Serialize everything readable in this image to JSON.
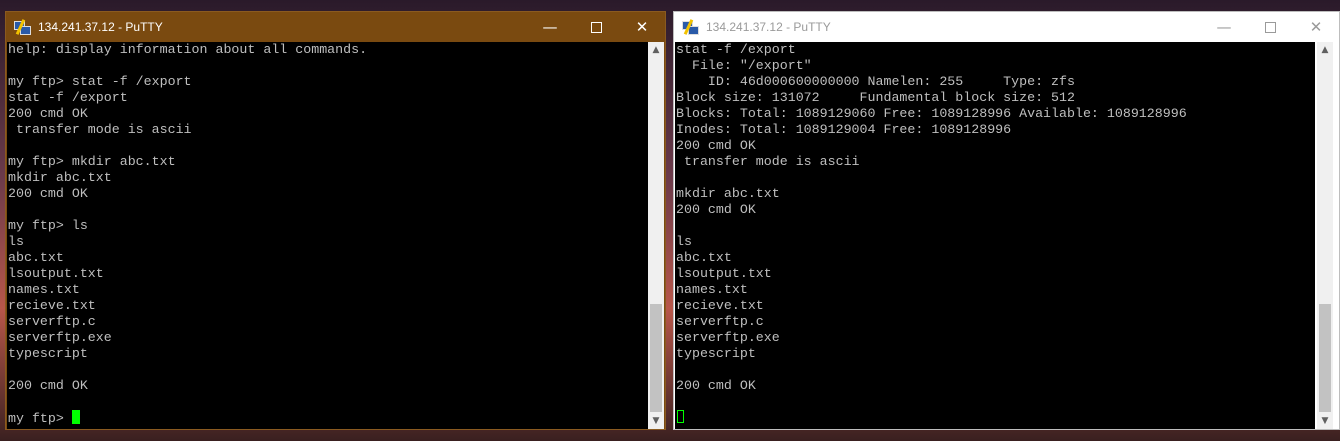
{
  "left_window": {
    "title": "134.241.37.12 - PuTTY",
    "controls": {
      "minimize": "—",
      "close": "✕"
    },
    "lines": [
      "help: display information about all commands.",
      "",
      "my ftp> stat -f /export",
      "stat -f /export",
      "200 cmd OK",
      " transfer mode is ascii",
      "",
      "my ftp> mkdir abc.txt",
      "mkdir abc.txt",
      "200 cmd OK",
      "",
      "my ftp> ls",
      "ls",
      "abc.txt",
      "lsoutput.txt",
      "names.txt",
      "recieve.txt",
      "serverftp.c",
      "serverftp.exe",
      "typescript",
      "",
      "200 cmd OK",
      ""
    ],
    "prompt": "my ftp> ",
    "scroll": {
      "up": "▲",
      "down": "▼"
    }
  },
  "right_window": {
    "title": "134.241.37.12 - PuTTY",
    "controls": {
      "minimize": "—",
      "close": "✕"
    },
    "lines": [
      "stat -f /export",
      "  File: \"/export\"",
      "    ID: 46d000600000000 Namelen: 255     Type: zfs",
      "Block size: 131072     Fundamental block size: 512",
      "Blocks: Total: 1089129060 Free: 1089128996 Available: 1089128996",
      "Inodes: Total: 1089129004 Free: 1089128996",
      "200 cmd OK",
      " transfer mode is ascii",
      "",
      "mkdir abc.txt",
      "200 cmd OK",
      "",
      "ls",
      "abc.txt",
      "lsoutput.txt",
      "names.txt",
      "recieve.txt",
      "serverftp.c",
      "serverftp.exe",
      "typescript",
      "",
      "200 cmd OK",
      ""
    ],
    "scroll": {
      "up": "▲",
      "down": "▼"
    }
  }
}
